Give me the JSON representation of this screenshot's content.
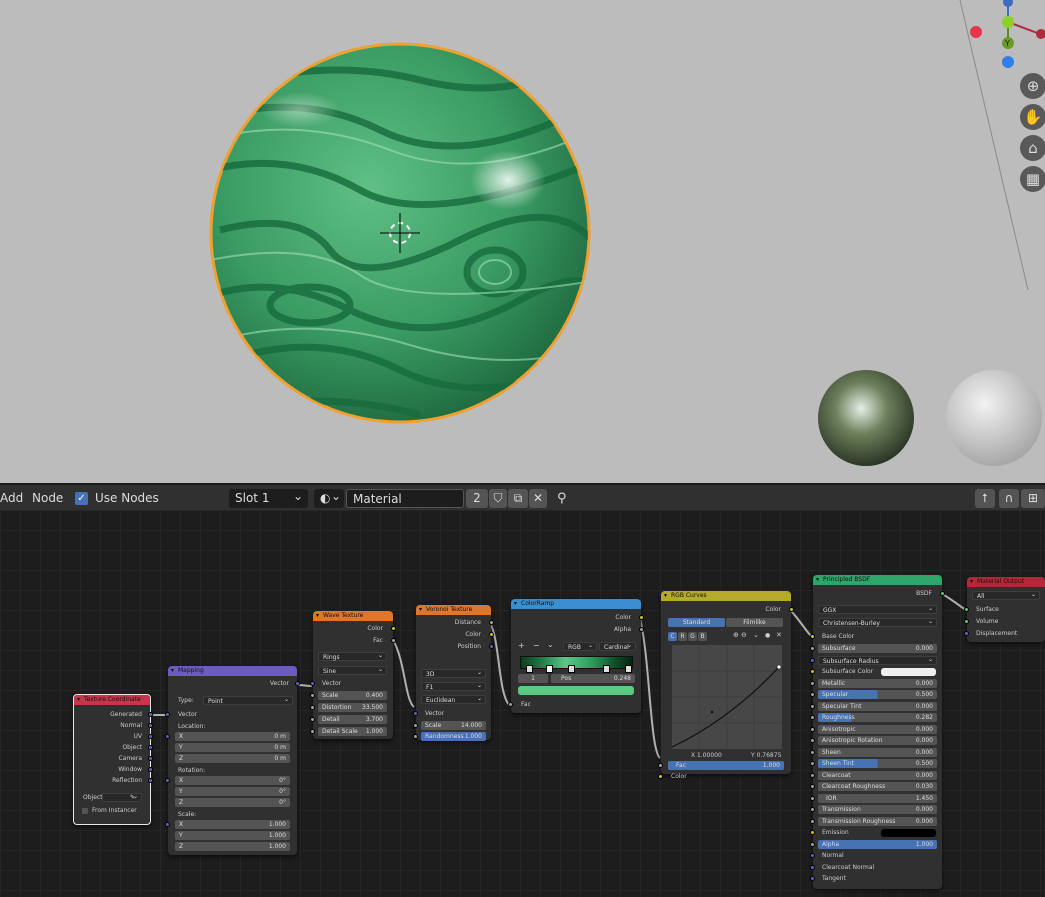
{
  "header": {
    "add_label": "Add",
    "node_label": "Node",
    "use_nodes_label": "Use Nodes",
    "slot_value": "Slot 1",
    "material_name": "Material",
    "user_count": "2"
  },
  "nodes": {
    "texcoord": {
      "title": "Texture Coordinate",
      "outputs": [
        "Generated",
        "Normal",
        "UV",
        "Object",
        "Camera",
        "Window",
        "Reflection"
      ],
      "object_label": "Object",
      "from_instancer": "From Instancer"
    },
    "mapping": {
      "title": "Mapping",
      "output": "Vector",
      "type_label": "Type:",
      "type_value": "Point",
      "vector_label": "Vector",
      "location_label": "Location:",
      "location": [
        [
          "X",
          "0 m"
        ],
        [
          "Y",
          "0 m"
        ],
        [
          "Z",
          "0 m"
        ]
      ],
      "rotation_label": "Rotation:",
      "rotation": [
        [
          "X",
          "0°"
        ],
        [
          "Y",
          "0°"
        ],
        [
          "Z",
          "0°"
        ]
      ],
      "scale_label": "Scale:",
      "scale": [
        [
          "X",
          "1.000"
        ],
        [
          "Y",
          "1.000"
        ],
        [
          "Z",
          "1.000"
        ]
      ]
    },
    "wave": {
      "title": "Wave Texture",
      "outputs": [
        "Color",
        "Fac"
      ],
      "type_value": "Rings",
      "profile_value": "Sine",
      "vector_label": "Vector",
      "fields": [
        [
          "Scale",
          "0.400"
        ],
        [
          "Distortion",
          "33.500"
        ],
        [
          "Detail",
          "3.700"
        ],
        [
          "Detail Scale",
          "1.000"
        ]
      ]
    },
    "voronoi": {
      "title": "Voronoi Texture",
      "outputs": [
        "Distance",
        "Color",
        "Position"
      ],
      "dims_value": "3D",
      "feature_value": "F1",
      "metric_value": "Euclidean",
      "vector_label": "Vector",
      "fields": [
        [
          "Scale",
          "14.000"
        ],
        [
          "Randomness",
          "1.000"
        ]
      ]
    },
    "colorramp": {
      "title": "ColorRamp",
      "outputs": [
        "Color",
        "Alpha"
      ],
      "mode_value": "RGB",
      "interp_value": "Cardinal",
      "index_value": "1",
      "pos_label": "Pos",
      "pos_value": "0.248",
      "input": "Fac"
    },
    "rgbcurves": {
      "title": "RGB Curves",
      "output": "Color",
      "tab_standard": "Standard",
      "tab_filmlike": "Filmlike",
      "channels": [
        "C",
        "R",
        "G",
        "B"
      ],
      "x_readout": "X 1.00000",
      "y_readout": "Y 0.76875",
      "fac_label": "Fac",
      "fac_value": "1.000",
      "color_input": "Color"
    },
    "bsdf": {
      "title": "Principled BSDF",
      "output": "BSDF",
      "distribution": "GGX",
      "subsurface_method": "Christensen-Burley",
      "base_color": "Base Color",
      "fields": [
        [
          "Subsurface",
          "0.000"
        ],
        [
          "Subsurface Radius",
          ""
        ],
        [
          "Subsurface Color",
          ""
        ],
        [
          "Metallic",
          "0.000"
        ],
        [
          "Specular",
          "0.500"
        ],
        [
          "Specular Tint",
          "0.000"
        ],
        [
          "Roughness",
          "0.282"
        ],
        [
          "Anisotropic",
          "0.000"
        ],
        [
          "Anisotropic Rotation",
          "0.000"
        ],
        [
          "Sheen",
          "0.000"
        ],
        [
          "Sheen Tint",
          "0.500"
        ],
        [
          "Clearcoat",
          "0.000"
        ],
        [
          "Clearcoat Roughness",
          "0.030"
        ],
        [
          "IOR",
          "1.450"
        ],
        [
          "Transmission",
          "0.000"
        ],
        [
          "Transmission Roughness",
          "0.000"
        ],
        [
          "Emission",
          ""
        ],
        [
          "Alpha",
          "1.000"
        ]
      ],
      "vectors": [
        "Normal",
        "Clearcoat Normal",
        "Tangent"
      ]
    },
    "output": {
      "title": "Material Output",
      "target_value": "All",
      "inputs": [
        "Surface",
        "Volume",
        "Displacement"
      ]
    }
  },
  "colors": {
    "texcoord_header": "#c7354b",
    "mapping_header": "#6c5bc4",
    "texture_header": "#e0762b",
    "converter_header": "#3a8fd0",
    "color_header": "#b5aa2c",
    "shader_header": "#2ea66a",
    "output_header": "#b22a3a",
    "selection": "#ffa500",
    "accent": "#4772b3"
  }
}
